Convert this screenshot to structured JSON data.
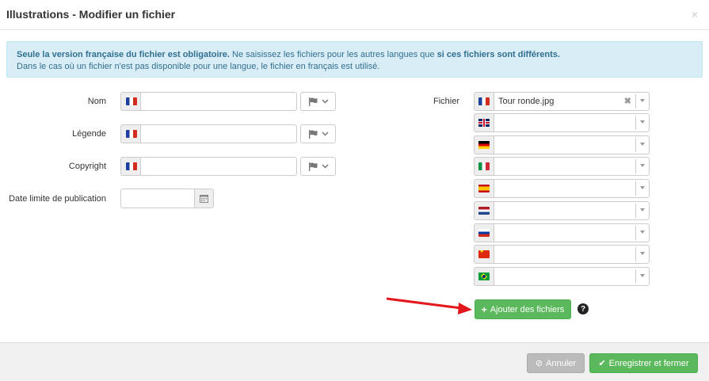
{
  "modal": {
    "title": "Illustrations - Modifier un fichier",
    "close": "×"
  },
  "alert": {
    "line1_bold": "Seule la version française du fichier est obligatoire.",
    "line1_mid": " Ne saisissez les fichiers pour les autres langues que ",
    "line1_bold2": "si ces fichiers sont différents.",
    "line2": "Dans le cas où un fichier n'est pas disponible pour une langue, le fichier en français est utilisé."
  },
  "form": {
    "nom_label": "Nom",
    "legende_label": "Légende",
    "copyright_label": "Copyright",
    "date_label": "Date limite de publication",
    "fichier_label": "Fichier"
  },
  "files": [
    {
      "flag": "fr",
      "value": "Tour ronde.jpg"
    },
    {
      "flag": "gb",
      "value": ""
    },
    {
      "flag": "de",
      "value": ""
    },
    {
      "flag": "it",
      "value": ""
    },
    {
      "flag": "es",
      "value": ""
    },
    {
      "flag": "nl",
      "value": ""
    },
    {
      "flag": "ru",
      "value": ""
    },
    {
      "flag": "cn",
      "value": ""
    },
    {
      "flag": "br",
      "value": ""
    }
  ],
  "buttons": {
    "add_files": "Ajouter des fichiers",
    "help": "?",
    "cancel": "Annuler",
    "save_close": "Enregistrer et fermer"
  },
  "colors": {
    "success": "#5cb85c",
    "info_bg": "#d9edf7",
    "info_text": "#31708f",
    "disabled": "#bbbbbb"
  }
}
